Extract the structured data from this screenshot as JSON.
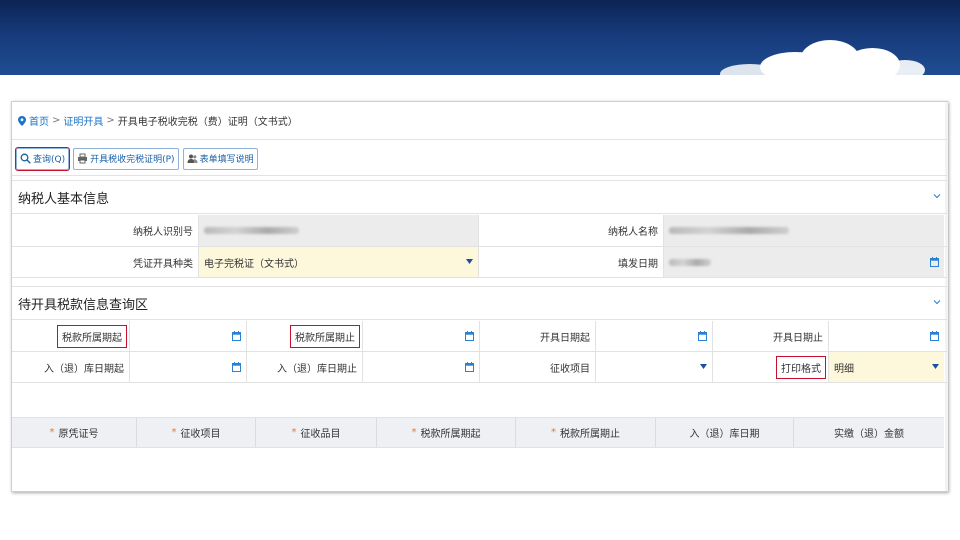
{
  "breadcrumb": {
    "home": "首页",
    "sep1": ">",
    "level1": "证明开具",
    "sep2": ">",
    "current": "开具电子税收完税（费）证明（文书式）"
  },
  "toolbar": {
    "query_label": "查询(Q)",
    "issue_label": "开具税收完税证明(P)",
    "guide_label": "表单填写说明"
  },
  "taxpayer_section": {
    "title": "纳税人基本信息",
    "tax_id_label": "纳税人识别号",
    "name_label": "纳税人名称",
    "voucher_type_label": "凭证开具种类",
    "voucher_type_value": "电子完税证（文书式）",
    "issue_date_label": "填发日期"
  },
  "query_section": {
    "title": "待开具税款信息查询区",
    "period_start_label": "税款所属期起",
    "period_end_label": "税款所属期止",
    "issue_date_start_label": "开具日期起",
    "issue_date_end_label": "开具日期止",
    "storage_date_start_label": "入（退）库日期起",
    "storage_date_end_label": "入（退）库日期止",
    "levy_item_label": "征收项目",
    "print_format_label": "打印格式",
    "print_format_value": "明细"
  },
  "table": {
    "columns": [
      {
        "label": "原凭证号",
        "required": true
      },
      {
        "label": "征收项目",
        "required": true
      },
      {
        "label": "征收品目",
        "required": true
      },
      {
        "label": "税款所属期起",
        "required": true
      },
      {
        "label": "税款所属期止",
        "required": true
      },
      {
        "label": "入（退）库日期",
        "required": false
      },
      {
        "label": "实缴（退）金额",
        "required": false
      }
    ],
    "required_mark": "*"
  },
  "colors": {
    "banner": "#173a7a",
    "link": "#1a73c8",
    "highlight": "#c8102e",
    "readonly_bg": "#ececec",
    "editable_bg": "#fdf7dc",
    "icon": "#2b7fd4"
  }
}
